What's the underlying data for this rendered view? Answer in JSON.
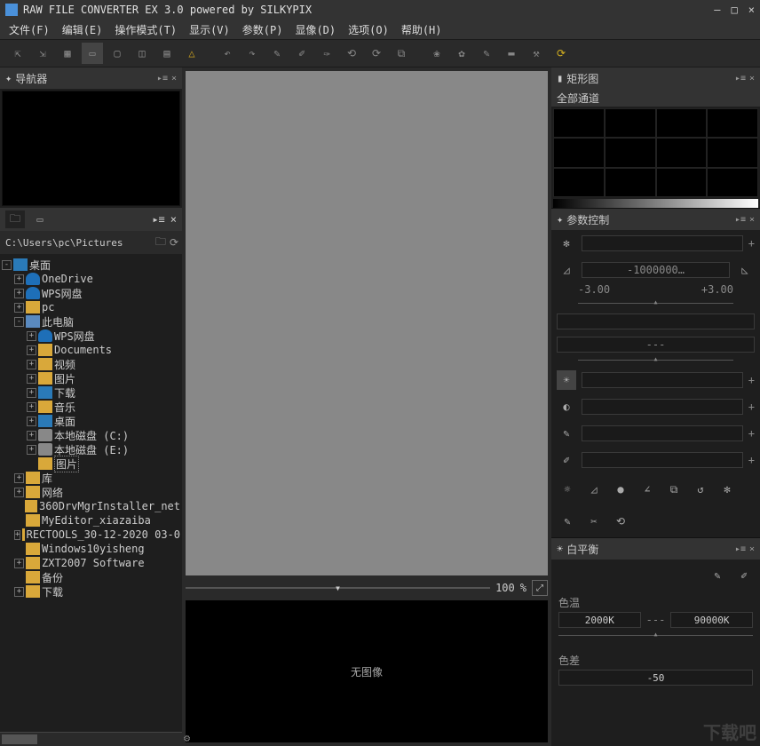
{
  "title": "RAW FILE CONVERTER EX 3.0 powered by SILKYPIX",
  "menu": [
    "文件(F)",
    "编辑(E)",
    "操作模式(T)",
    "显示(V)",
    "参数(P)",
    "显像(D)",
    "选项(O)",
    "帮助(H)"
  ],
  "nav_panel": "导航器",
  "path": "C:\\Users\\pc\\Pictures",
  "tree": [
    {
      "d": 0,
      "exp": "-",
      "icon": "desktop",
      "label": "桌面"
    },
    {
      "d": 1,
      "exp": "+",
      "icon": "cloud",
      "label": "OneDrive"
    },
    {
      "d": 1,
      "exp": "+",
      "icon": "cloud",
      "label": "WPS网盘"
    },
    {
      "d": 1,
      "exp": "+",
      "icon": "folder",
      "label": "pc"
    },
    {
      "d": 1,
      "exp": "-",
      "icon": "pc",
      "label": "此电脑"
    },
    {
      "d": 2,
      "exp": "+",
      "icon": "cloud",
      "label": "WPS网盘"
    },
    {
      "d": 2,
      "exp": "+",
      "icon": "folder",
      "label": "Documents"
    },
    {
      "d": 2,
      "exp": "+",
      "icon": "folder",
      "label": "视频"
    },
    {
      "d": 2,
      "exp": "+",
      "icon": "folder",
      "label": "图片"
    },
    {
      "d": 2,
      "exp": "+",
      "icon": "down",
      "label": "下载"
    },
    {
      "d": 2,
      "exp": "+",
      "icon": "folder",
      "label": "音乐"
    },
    {
      "d": 2,
      "exp": "+",
      "icon": "desktop",
      "label": "桌面"
    },
    {
      "d": 2,
      "exp": "+",
      "icon": "drive",
      "label": "本地磁盘 (C:)"
    },
    {
      "d": 2,
      "exp": "+",
      "icon": "drive",
      "label": "本地磁盘 (E:)"
    },
    {
      "d": 2,
      "exp": "",
      "icon": "folder",
      "label": "图片",
      "sel": true
    },
    {
      "d": 1,
      "exp": "+",
      "icon": "folder",
      "label": "库"
    },
    {
      "d": 1,
      "exp": "+",
      "icon": "folder",
      "label": "网络"
    },
    {
      "d": 1,
      "exp": "",
      "icon": "folder",
      "label": "360DrvMgrInstaller_net"
    },
    {
      "d": 1,
      "exp": "",
      "icon": "folder",
      "label": "MyEditor_xiazaiba"
    },
    {
      "d": 1,
      "exp": "+",
      "icon": "folder",
      "label": "RECTOOLS_30-12-2020 03-0"
    },
    {
      "d": 1,
      "exp": "",
      "icon": "folder",
      "label": "Windows10yisheng"
    },
    {
      "d": 1,
      "exp": "+",
      "icon": "folder",
      "label": "ZXT2007 Software"
    },
    {
      "d": 1,
      "exp": "",
      "icon": "folder",
      "label": "备份"
    },
    {
      "d": 1,
      "exp": "+",
      "icon": "folder",
      "label": "下载"
    }
  ],
  "zoom": {
    "value": "100",
    "unit": "%"
  },
  "no_image": "无图像",
  "histo_panel": "矩形图",
  "channels": "全部通道",
  "param_panel": "参数控制",
  "exposure": {
    "value": "-1000000…",
    "min": "-3.00",
    "max": "+3.00",
    "mid": "---"
  },
  "wb_panel": "白平衡",
  "wb_temp": {
    "label": "色温",
    "min": "2000K",
    "mid": "---",
    "max": "90000K"
  },
  "wb_tint": {
    "label": "色差",
    "min": "-50",
    "mid": "",
    "max": ""
  },
  "watermark": "下载吧"
}
